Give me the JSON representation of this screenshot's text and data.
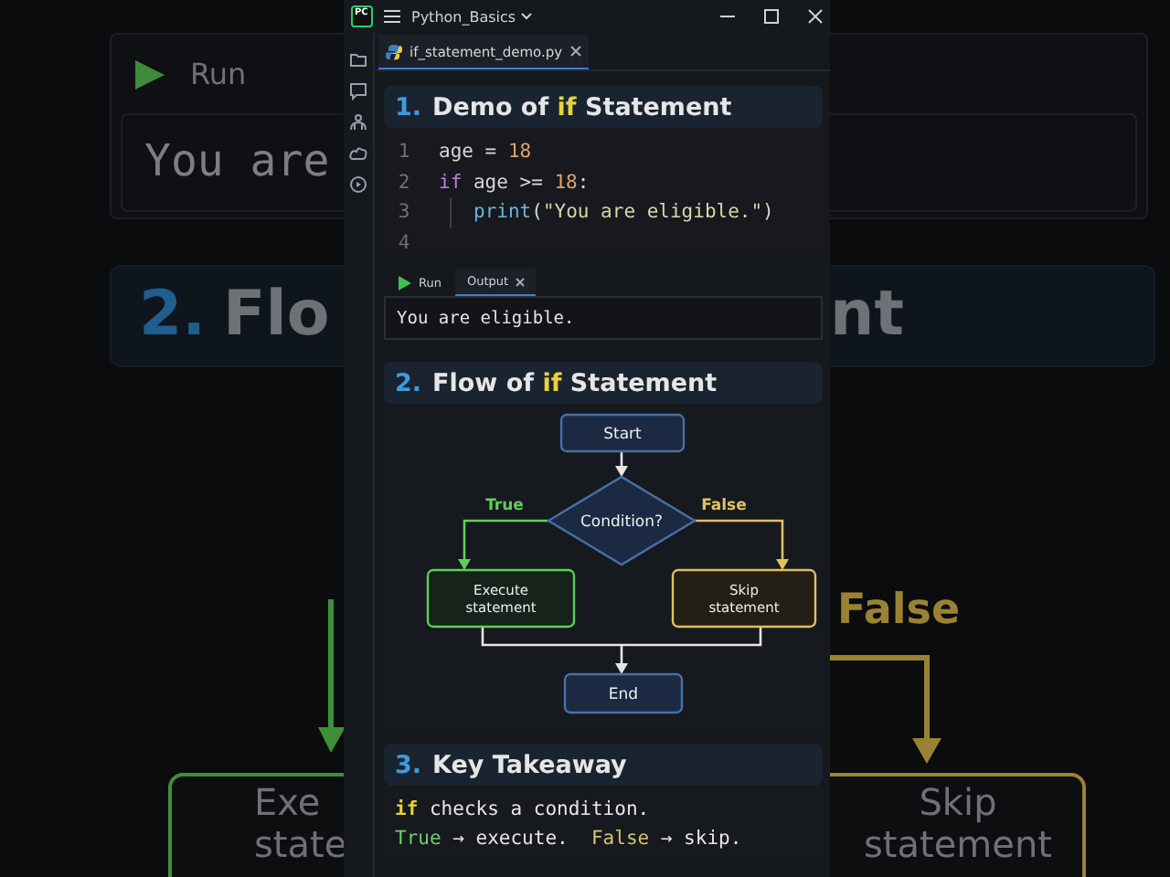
{
  "backdrop": {
    "left": {
      "run_label": "Run",
      "output": "You are",
      "section_number": "2.",
      "section_title": "Flo",
      "node_lines": [
        "Exe",
        "state"
      ]
    },
    "right": {
      "section_title": "nt",
      "branch_label": "False",
      "node_lines": [
        "Skip",
        "statement"
      ]
    }
  },
  "window": {
    "logo": "PC",
    "project": "Python_Basics"
  },
  "tabs": [
    {
      "label": "if_statement_demo.py",
      "selected": true
    }
  ],
  "sections": [
    {
      "number": "1.",
      "title": [
        {
          "kind": "plain",
          "text": "Demo of "
        },
        {
          "kind": "keyword",
          "text": "if"
        },
        {
          "kind": "plain",
          "text": " Statement"
        }
      ]
    },
    {
      "number": "2.",
      "title": [
        {
          "kind": "plain",
          "text": "Flow of "
        },
        {
          "kind": "keyword",
          "text": "if"
        },
        {
          "kind": "plain",
          "text": " Statement"
        }
      ]
    },
    {
      "number": "3.",
      "title": [
        {
          "kind": "plain",
          "text": "Key Takeaway"
        }
      ]
    }
  ],
  "code": [
    {
      "number": "1",
      "indented": false,
      "tokens": [
        {
          "kind": "name",
          "text": "age"
        },
        {
          "kind": "op",
          "text": " = "
        },
        {
          "kind": "number",
          "text": "18"
        }
      ]
    },
    {
      "number": "2",
      "indented": false,
      "tokens": [
        {
          "kind": "keyword",
          "text": "if"
        },
        {
          "kind": "name",
          "text": " age "
        },
        {
          "kind": "op",
          "text": ">= "
        },
        {
          "kind": "number",
          "text": "18"
        },
        {
          "kind": "op",
          "text": ":"
        }
      ]
    },
    {
      "number": "3",
      "indented": true,
      "tokens": [
        {
          "kind": "func",
          "text": "print"
        },
        {
          "kind": "op",
          "text": "("
        },
        {
          "kind": "string",
          "text": "\"You are eligible.\""
        },
        {
          "kind": "op",
          "text": ")"
        }
      ]
    },
    {
      "number": "4"
    }
  ],
  "run_panel": {
    "tabs": [
      {
        "label": "Run",
        "kind": "run",
        "selected": false
      },
      {
        "label": "Output",
        "kind": "output",
        "selected": true
      }
    ],
    "output": "You are eligible."
  },
  "flowchart": {
    "nodes": [
      {
        "kind": "terminal",
        "lines": [
          "Start"
        ],
        "color": "#4a6fa8"
      },
      {
        "kind": "decision",
        "lines": [
          "Condition?"
        ],
        "color": "#4a6fa8"
      },
      {
        "kind": "process",
        "lines": [
          "Execute",
          "statement"
        ],
        "color": "#5fcf5a"
      },
      {
        "kind": "process",
        "lines": [
          "Skip",
          "statement"
        ],
        "color": "#e0c060"
      },
      {
        "kind": "terminal",
        "lines": [
          "End"
        ],
        "color": "#4a6fa8"
      }
    ],
    "branches": [
      {
        "label": "True",
        "color": "#5fcf5a"
      },
      {
        "label": "False",
        "color": "#e0c060"
      }
    ]
  },
  "takeaway": [
    [
      {
        "kind": "keyword",
        "text": "if"
      },
      {
        "kind": "plain",
        "text": " checks a condition."
      }
    ],
    [
      {
        "kind": "true",
        "text": "True"
      },
      {
        "kind": "plain",
        "text": " → execute.  "
      },
      {
        "kind": "false",
        "text": "False"
      },
      {
        "kind": "plain",
        "text": " → skip."
      }
    ]
  ]
}
